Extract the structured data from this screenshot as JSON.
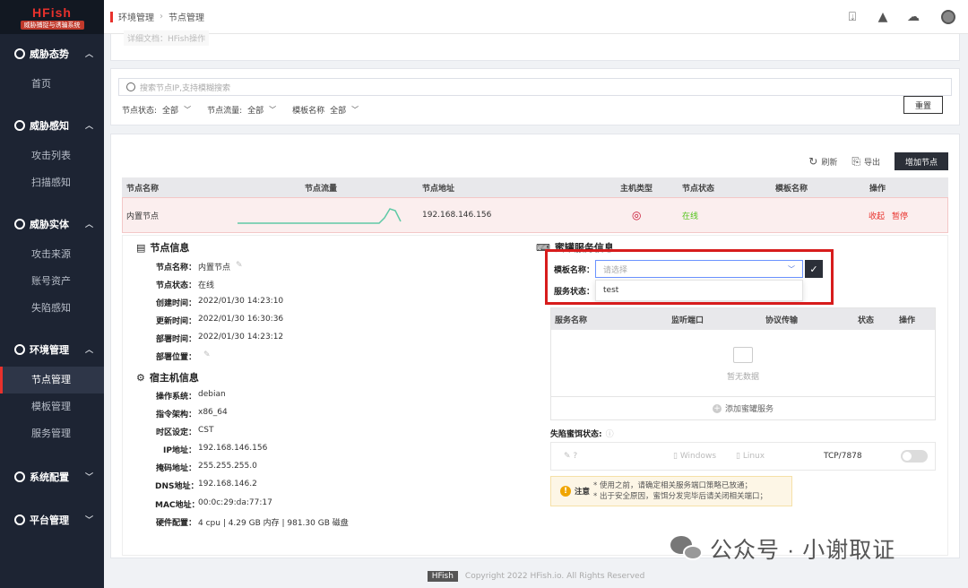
{
  "app": {
    "logo_title": "HFish",
    "logo_subtitle": "威胁捕捉与诱骗系统"
  },
  "sidebar": {
    "groups": [
      {
        "label": "威胁态势",
        "items": [
          "首页"
        ]
      },
      {
        "label": "威胁感知",
        "items": [
          "攻击列表",
          "扫描感知"
        ]
      },
      {
        "label": "威胁实体",
        "items": [
          "攻击来源",
          "账号资产",
          "失陷感知"
        ]
      },
      {
        "label": "环境管理",
        "items": [
          "节点管理",
          "模板管理",
          "服务管理"
        ]
      },
      {
        "label": "系统配置",
        "items": []
      },
      {
        "label": "平台管理",
        "items": []
      }
    ],
    "active_item": "节点管理"
  },
  "breadcrumb": {
    "parent": "环境管理",
    "current": "节点管理"
  },
  "top_partial": {
    "text": "详细文档：HFish操作"
  },
  "search": {
    "placeholder": "搜索节点IP,支持模糊搜索"
  },
  "filters": [
    {
      "label": "节点状态:",
      "value": "全部"
    },
    {
      "label": "节点流量:",
      "value": "全部"
    },
    {
      "label": "模板名称",
      "value": "全部"
    }
  ],
  "reset_label": "重置",
  "toolbar": {
    "refresh": "刷新",
    "export": "导出",
    "add_node": "增加节点"
  },
  "table": {
    "headers": [
      "节点名称",
      "节点流量",
      "节点地址",
      "主机类型",
      "节点状态",
      "模板名称",
      "操作"
    ],
    "row": {
      "name": "内置节点",
      "address": "192.168.146.156",
      "status": "在线",
      "template": "",
      "action_collapse": "收起",
      "action_pause": "暂停"
    }
  },
  "node_info": {
    "title": "节点信息",
    "fields": [
      {
        "k": "节点名称：",
        "v": "内置节点"
      },
      {
        "k": "节点状态：",
        "v": "在线"
      },
      {
        "k": "创建时间：",
        "v": "2022/01/30 14:23:10"
      },
      {
        "k": "更新时间：",
        "v": "2022/01/30 16:30:36"
      },
      {
        "k": "部署时间：",
        "v": "2022/01/30 14:23:12"
      },
      {
        "k": "部署位置：",
        "v": ""
      }
    ]
  },
  "host_info": {
    "title": "宿主机信息",
    "fields": [
      {
        "k": "操作系统：",
        "v": "debian"
      },
      {
        "k": "指令架构：",
        "v": "x86_64"
      },
      {
        "k": "时区设定：",
        "v": "CST"
      },
      {
        "k": "IP地址：",
        "v": "192.168.146.156"
      },
      {
        "k": "掩码地址：",
        "v": "255.255.255.0"
      },
      {
        "k": "DNS地址：",
        "v": "192.168.146.2"
      },
      {
        "k": "MAC地址：",
        "v": "00:0c:29:da:77:17"
      },
      {
        "k": "硬件配置：",
        "v": "4 cpu | 4.29 GB 内存 | 981.30 GB 磁盘"
      }
    ]
  },
  "honeypot": {
    "title": "蜜罐服务信息",
    "template_label": "模板名称：",
    "template_placeholder": "请选择",
    "dropdown_option": "test",
    "status_label": "服务状态：",
    "service_headers": [
      "服务名称",
      "监听端口",
      "协议传输",
      "状态",
      "操作"
    ],
    "empty_text": "暂无数据",
    "add_service": "添加蜜罐服务",
    "lure_title": "失陷蜜饵状态:",
    "lure_windows": "Windows",
    "lure_linux": "Linux",
    "lure_port": "TCP/7878",
    "notice_title": "注意",
    "notice_lines": [
      "* 使用之前，请确定相关服务端口策略已放通；",
      "* 出于安全原因，蜜饵分发完毕后请关闭相关端口；"
    ]
  },
  "footer": {
    "badge": "HFish",
    "copyright": "Copyright 2022 HFish.io. All Rights Reserved"
  },
  "watermark": "公众号 · 小谢取证",
  "colors": {
    "accent": "#e8312c",
    "sidebar": "#1d2433",
    "online": "#52c41a",
    "highlight_box": "#d71c1c"
  }
}
